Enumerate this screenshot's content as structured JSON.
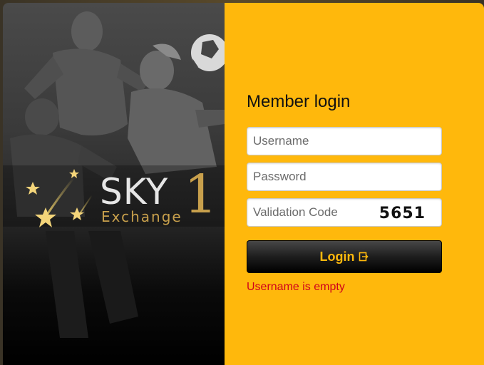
{
  "brand": {
    "name_main": "SKY",
    "name_number": "1",
    "name_sub": "Exchange"
  },
  "login": {
    "title": "Member login",
    "username_placeholder": "Username",
    "password_placeholder": "Password",
    "validation_placeholder": "Validation Code",
    "captcha_code": "5651",
    "button_label": "Login",
    "error_message": "Username is empty"
  },
  "colors": {
    "accent": "#ffb80c",
    "error": "#d0021b",
    "logo_gold": "#c8a04c"
  },
  "icons": {
    "login_icon": "logout-arrow-icon"
  }
}
